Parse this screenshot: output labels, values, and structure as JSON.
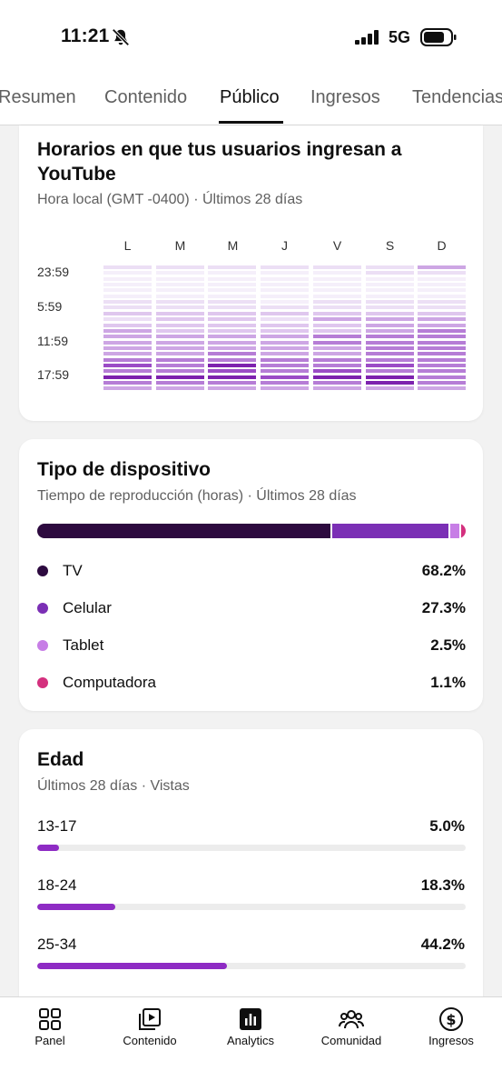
{
  "status_bar": {
    "time": "11:21",
    "network": "5G"
  },
  "tabs": [
    {
      "label": "Resumen",
      "active": false
    },
    {
      "label": "Contenido",
      "active": false
    },
    {
      "label": "Público",
      "active": true
    },
    {
      "label": "Ingresos",
      "active": false
    },
    {
      "label": "Tendencias",
      "active": false
    }
  ],
  "hours_card": {
    "title_line1": "Horarios en que tus usuarios ingresan a",
    "title_line2": "YouTube",
    "subtitle": "Hora local (GMT -0400) · Últimos 28 días",
    "days": [
      "L",
      "M",
      "M",
      "J",
      "V",
      "S",
      "D"
    ],
    "hour_labels": [
      "23:59",
      "5:59",
      "11:59",
      "17:59"
    ],
    "heatmap_levels": [
      [
        1,
        1,
        1,
        1,
        1,
        1,
        3
      ],
      [
        0,
        0,
        0,
        0,
        0,
        1,
        1
      ],
      [
        0,
        0,
        0,
        0,
        0,
        0,
        0
      ],
      [
        0,
        0,
        0,
        0,
        0,
        0,
        0
      ],
      [
        0,
        0,
        0,
        0,
        0,
        0,
        0
      ],
      [
        0,
        0,
        0,
        0,
        0,
        0,
        0
      ],
      [
        1,
        1,
        1,
        0,
        1,
        1,
        1
      ],
      [
        1,
        1,
        1,
        1,
        1,
        1,
        1
      ],
      [
        2,
        2,
        2,
        2,
        2,
        2,
        2
      ],
      [
        1,
        2,
        2,
        1,
        3,
        3,
        3
      ],
      [
        2,
        2,
        2,
        2,
        2,
        3,
        3
      ],
      [
        3,
        2,
        2,
        2,
        2,
        3,
        4
      ],
      [
        3,
        3,
        3,
        3,
        4,
        4,
        4
      ],
      [
        3,
        3,
        3,
        3,
        4,
        4,
        4
      ],
      [
        3,
        3,
        3,
        3,
        3,
        4,
        4
      ],
      [
        3,
        3,
        4,
        3,
        3,
        4,
        4
      ],
      [
        4,
        4,
        4,
        4,
        4,
        4,
        4
      ],
      [
        5,
        4,
        6,
        4,
        4,
        5,
        4
      ],
      [
        4,
        4,
        5,
        4,
        5,
        4,
        4
      ],
      [
        6,
        6,
        6,
        5,
        6,
        6,
        4
      ],
      [
        4,
        4,
        4,
        4,
        4,
        6,
        4
      ],
      [
        3,
        3,
        3,
        3,
        3,
        3,
        3
      ]
    ],
    "heat_colors": [
      "#f5effa",
      "#ecdff5",
      "#dfc7ee",
      "#cda6e4",
      "#b67dd6",
      "#9b4cc6",
      "#7d22ae"
    ]
  },
  "device_card": {
    "title": "Tipo de dispositivo",
    "subtitle": "Tiempo de reproducción (horas) · Últimos 28 días",
    "items": [
      {
        "name": "TV",
        "pct_label": "68.2%",
        "value": 68.2,
        "color": "#2d0a3f"
      },
      {
        "name": "Celular",
        "pct_label": "27.3%",
        "value": 27.3,
        "color": "#7b2fb5"
      },
      {
        "name": "Tablet",
        "pct_label": "2.5%",
        "value": 2.5,
        "color": "#c77ee6"
      },
      {
        "name": "Computadora",
        "pct_label": "1.1%",
        "value": 1.1,
        "color": "#d4307e"
      }
    ]
  },
  "age_card": {
    "title": "Edad",
    "subtitle": "Últimos 28 días · Vistas",
    "groups": [
      {
        "range": "13-17",
        "pct_label": "5.0%",
        "value": 5.0
      },
      {
        "range": "18-24",
        "pct_label": "18.3%",
        "value": 18.3
      },
      {
        "range": "25-34",
        "pct_label": "44.2%",
        "value": 44.2
      }
    ]
  },
  "bottom_nav": [
    {
      "label": "Panel",
      "icon": "dashboard-icon"
    },
    {
      "label": "Contenido",
      "icon": "content-play-icon"
    },
    {
      "label": "Analytics",
      "icon": "analytics-icon",
      "active": true
    },
    {
      "label": "Comunidad",
      "icon": "community-icon"
    },
    {
      "label": "Ingresos",
      "icon": "dollar-circle-icon"
    }
  ]
}
